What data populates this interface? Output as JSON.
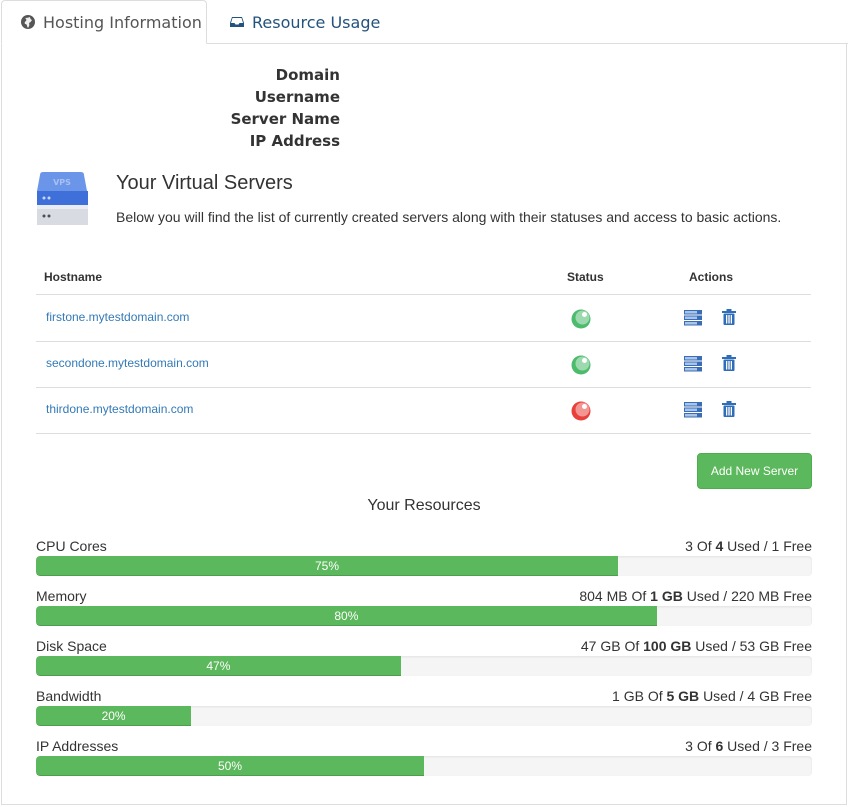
{
  "tabs": [
    {
      "label": "Hosting Information",
      "icon": "globe-icon",
      "active": true
    },
    {
      "label": "Resource Usage",
      "icon": "inbox-icon",
      "active": false
    }
  ],
  "info": {
    "labels": [
      "Domain",
      "Username",
      "Server Name",
      "IP Address"
    ]
  },
  "virtual_servers": {
    "icon": "vps-server-icon",
    "icon_text": "VPS",
    "title": "Your Virtual Servers",
    "description": "Below you will find the list of currently created servers along with their statuses and access to basic actions.",
    "columns": {
      "hostname": "Hostname",
      "status": "Status",
      "actions": "Actions"
    },
    "rows": [
      {
        "hostname": "firstone.mytestdomain.com",
        "status": "online",
        "status_color": "#4cbb6c"
      },
      {
        "hostname": "secondone.mytestdomain.com",
        "status": "online",
        "status_color": "#4cbb6c"
      },
      {
        "hostname": "thirdone.mytestdomain.com",
        "status": "offline",
        "status_color": "#e8413c"
      }
    ],
    "add_button": "Add New Server"
  },
  "resources": {
    "title": "Your Resources",
    "items": [
      {
        "label": "CPU Cores",
        "used": "3",
        "of": "Of",
        "total": "4",
        "tail": "Used / 1 Free",
        "percent": 75,
        "percent_label": "75%"
      },
      {
        "label": "Memory",
        "used": "804 MB",
        "of": "Of",
        "total": "1 GB",
        "tail": "Used / 220 MB Free",
        "percent": 80,
        "percent_label": "80%"
      },
      {
        "label": "Disk Space",
        "used": "47 GB",
        "of": "Of",
        "total": "100 GB",
        "tail": "Used / 53 GB Free",
        "percent": 47,
        "percent_label": "47%"
      },
      {
        "label": "Bandwidth",
        "used": "1 GB",
        "of": "Of",
        "total": "5 GB",
        "tail": "Used / 4 GB Free",
        "percent": 20,
        "percent_label": "20%"
      },
      {
        "label": "IP Addresses",
        "used": "3",
        "of": "Of",
        "total": "6",
        "tail": "Used / 3 Free",
        "percent": 50,
        "percent_label": "50%"
      }
    ]
  },
  "colors": {
    "accent_green": "#5cb85c",
    "link_blue": "#337ab7",
    "tab_blue": "#23527c"
  }
}
